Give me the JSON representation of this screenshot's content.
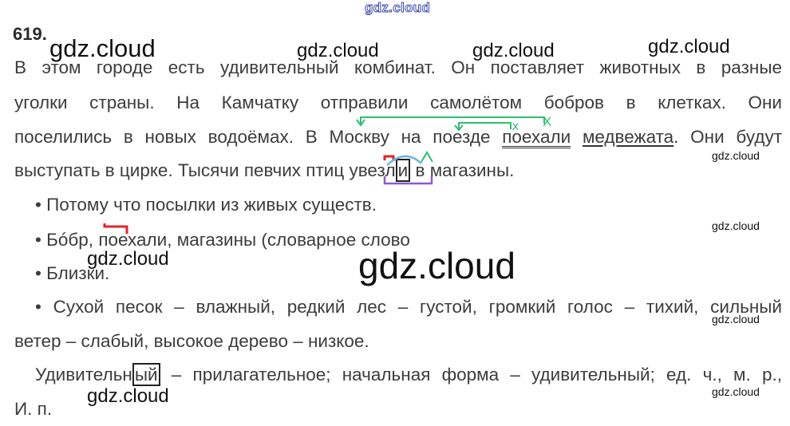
{
  "header_watermark": "gdz.cloud",
  "exercise_number": "619.",
  "paragraph": {
    "line1": "В этом городе есть удивительный комбинат. Он поставляет животных в разные",
    "line2": "уголки страны. На Камчатку отправили самолётом бобров в клетках. Они",
    "line3_a": "поселились в новых водоёмах. В Москву на поезде ",
    "line3_predicate": "поехали",
    "line3_subject": "медвежата",
    "line3_b": ". Они будут",
    "line4_a": "выступать в цирке. Тысячи певчих птиц ",
    "line4_root": "увез",
    "line4_suffix": "л",
    "line4_ending": "и",
    "line4_b": " в магазины."
  },
  "answers": {
    "bullet1": "• Потому что посылки из живых существ.",
    "bullet2_a": "• Бóбр, ",
    "bullet2_b": "поехали, магазины (словарное слово",
    "bullet3": "• Близки.",
    "bullet4_line1": "• Сухой песок – влажный, редкий лес – густой, громкий голос – тихий, сильный",
    "bullet4_line2": "ветер – слабый, высокое дерево – низкое."
  },
  "analysis": {
    "line1_a": "Удивительн",
    "line1_ending": "ый",
    "line1_b": " – прилагательное; начальная форма – удивительный; ед. ч., м. р.,",
    "line2": "И. п."
  },
  "watermarks": {
    "w1": "gdz.cloud",
    "w2": "gdz.cloud",
    "w3": "gdz.cloud",
    "w4": "gdz.cloud",
    "w5": "gdz.cloud",
    "w6": "gdz.cloud",
    "w7": "gdz.cloud",
    "w8": "gdz.cloud",
    "w9": "gdz.cloud",
    "w10": "gdz.cloud",
    "w11": "gdz.cloud"
  },
  "mark_colors": {
    "green": "#2fbf71",
    "teal": "#2fbf9a",
    "red": "#e0262a",
    "blue": "#6bb6e6",
    "purple": "#8a5cc8",
    "box": "#222222"
  },
  "mark_symbols": {
    "x1": "х",
    "x2": "Х"
  }
}
